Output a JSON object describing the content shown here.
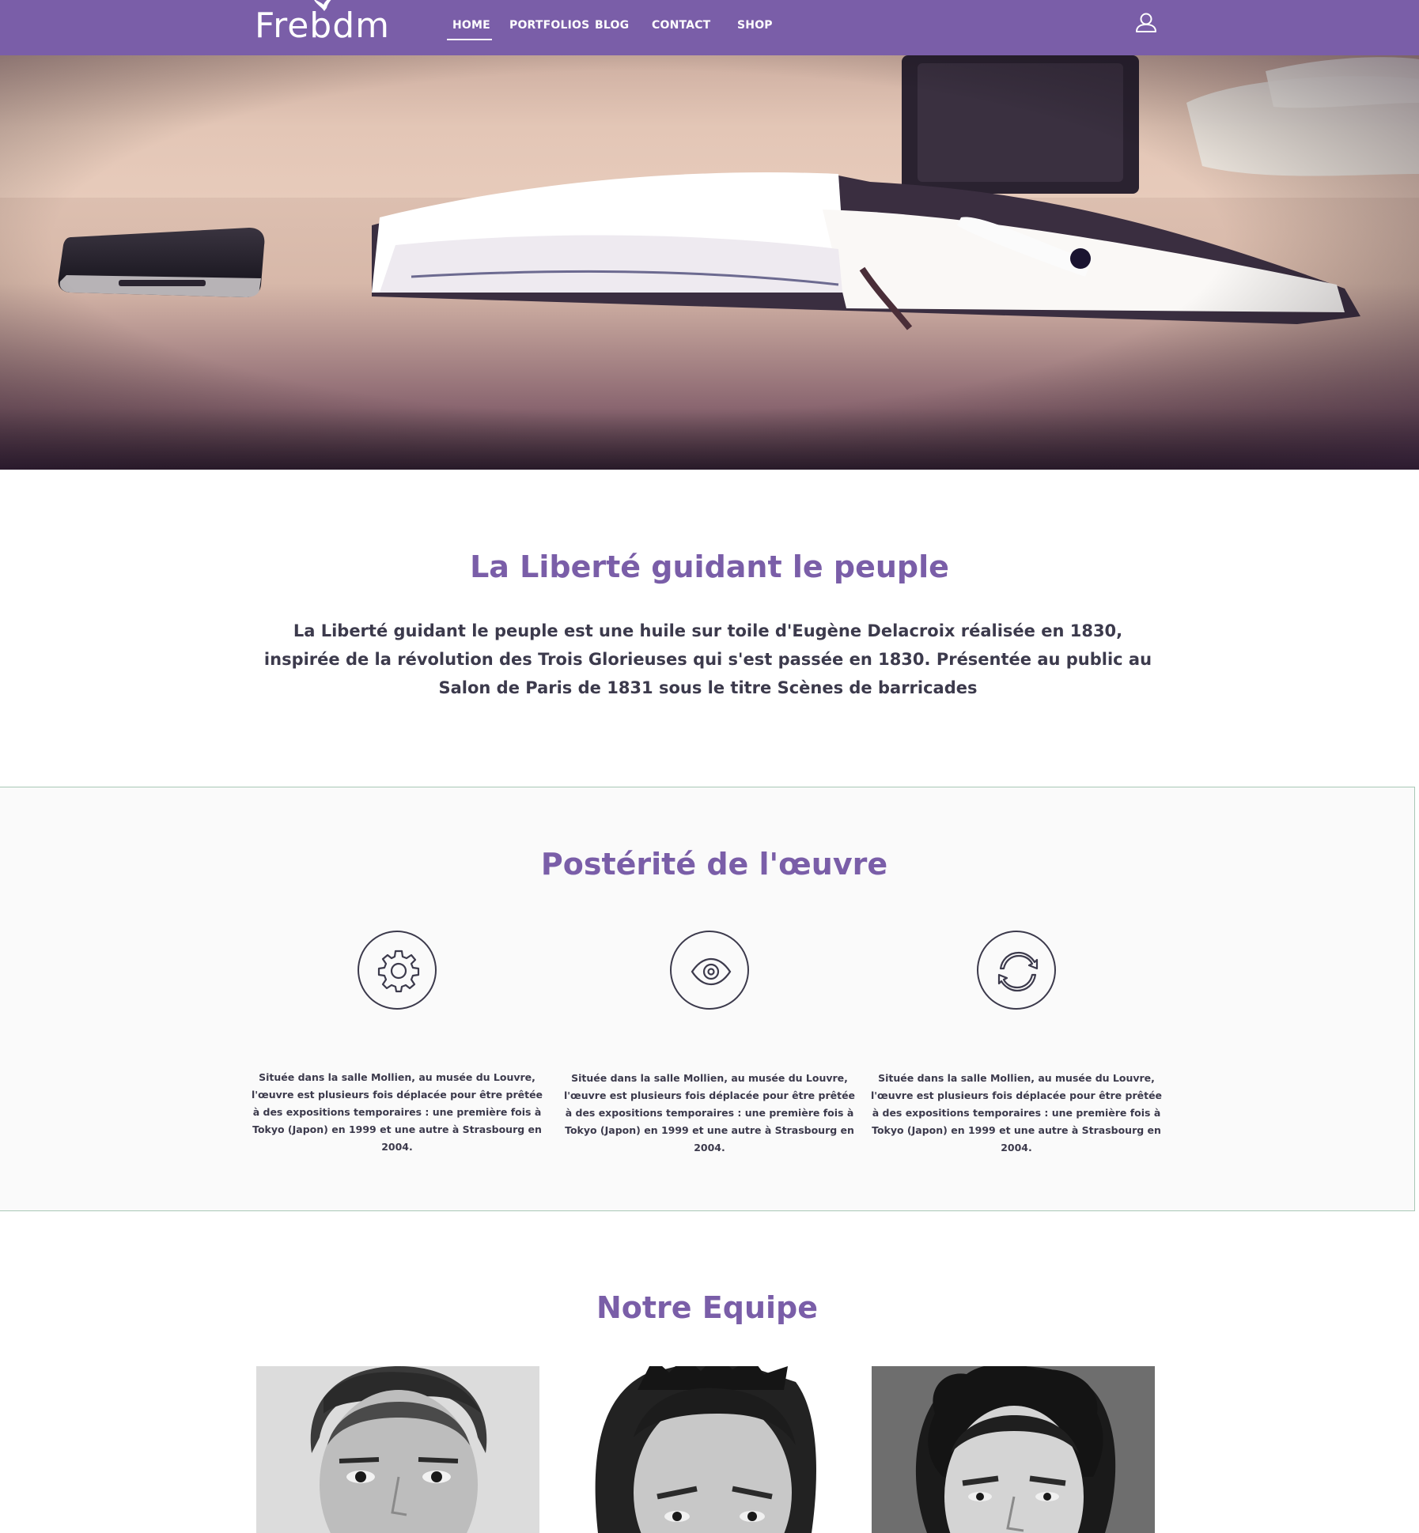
{
  "header": {
    "logo": "Frebdm",
    "nav": [
      {
        "label": "HOME",
        "active": true
      },
      {
        "label": "PORTFOLIOS",
        "active": false
      },
      {
        "label": "BLOG",
        "active": false
      },
      {
        "label": "CONTACT",
        "active": false
      },
      {
        "label": "SHOP",
        "active": false
      }
    ],
    "user_icon": "user-icon"
  },
  "hero": {
    "slides": 3,
    "active_slide": 1
  },
  "intro": {
    "title": "La Liberté guidant le peuple",
    "text": "La Liberté guidant  le peuple est une huile sur toile d'Eugène Delacroix réalisée en 1830, inspirée de la révolution des Trois Glorieuses qui s'est passée en 1830. Présentée au public au Salon de Paris de 1831 sous le titre Scènes de barricades"
  },
  "posterite": {
    "title": "Postérité de l'œuvre",
    "features": [
      {
        "icon": "gear-icon",
        "text": "Située dans la salle Mollien, au musée du Louvre, l'œuvre est plusieurs fois déplacée pour être prêtée à des expositions temporaires : une première fois à Tokyo (Japon) en 1999 et une autre à Strasbourg en 2004."
      },
      {
        "icon": "eye-icon",
        "text": "Située dans la salle Mollien, au musée du Louvre, l'œuvre est plusieurs fois déplacée pour être prêtée à des expositions temporaires : une première fois à Tokyo (Japon) en 1999 et une autre à Strasbourg en 2004."
      },
      {
        "icon": "refresh-icon",
        "text": "Située dans la salle Mollien, au musée du Louvre, l'œuvre est plusieurs fois déplacée pour être prêtée à des expositions temporaires : une première fois à Tokyo (Japon) en 1999 et une autre à Strasbourg en 2004."
      }
    ]
  },
  "team": {
    "title": "Notre Equipe"
  },
  "colors": {
    "brand": "#7a5ea8",
    "text": "#3c3a4c",
    "section_bg": "#fafafa",
    "section_border": "#a9c8b6"
  }
}
